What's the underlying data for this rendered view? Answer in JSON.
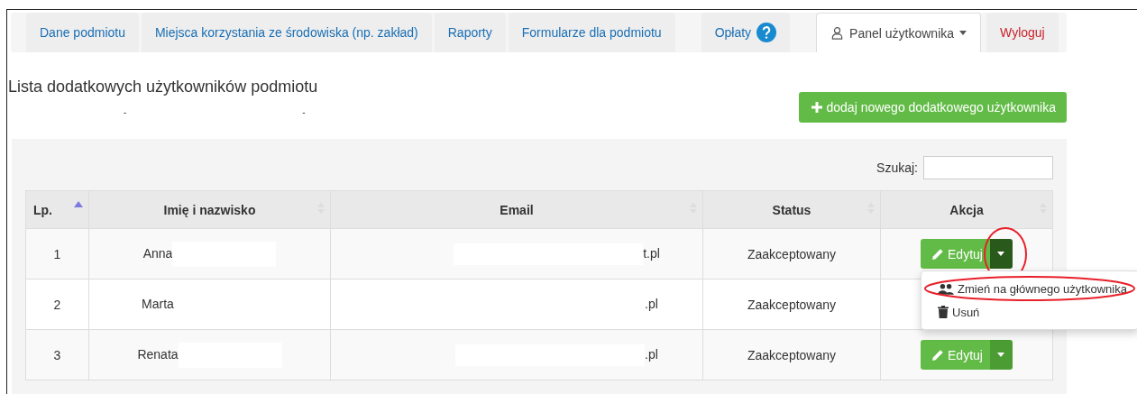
{
  "nav": {
    "tabs": [
      {
        "label": "Dane podmiotu",
        "selected": false,
        "kind": "link"
      },
      {
        "label": "Miejsca korzystania ze środowiska (np. zakład)",
        "selected": false,
        "kind": "link"
      },
      {
        "label": "Raporty",
        "selected": false,
        "kind": "link"
      },
      {
        "label": "Formularze dla podmiotu",
        "selected": false,
        "kind": "link"
      },
      {
        "label": "Opłaty",
        "selected": false,
        "kind": "help"
      },
      {
        "label": "Panel użytkownika",
        "selected": true,
        "kind": "user"
      },
      {
        "label": "Wyloguj",
        "selected": false,
        "kind": "logout"
      }
    ]
  },
  "page_title": "Lista dodatkowych użytkowników podmiotu",
  "redacted_line": [
    "-",
    "-"
  ],
  "add_button": "dodaj nowego dodatkowego użytkownika",
  "search": {
    "label": "Szukaj:"
  },
  "table": {
    "columns": [
      {
        "label": "Lp.",
        "sorted": true
      },
      {
        "label": "Imię i nazwisko",
        "sorted": false
      },
      {
        "label": "Email",
        "sorted": false
      },
      {
        "label": "Status",
        "sorted": false
      },
      {
        "label": "Akcja",
        "sorted": false
      }
    ],
    "rows": [
      {
        "lp": "1",
        "name": "Anna",
        "email": "t.pl",
        "status": "Zaakceptowany",
        "edit": "Edytuj",
        "menu_open": true,
        "circled": true
      },
      {
        "lp": "2",
        "name": "Marta",
        "email": ".pl",
        "status": "Zaakceptowany",
        "menu_open": false,
        "circled": false
      },
      {
        "lp": "3",
        "name": "Renata",
        "email": ".pl",
        "status": "Zaakceptowany",
        "edit": "Edytuj",
        "menu_open": false,
        "circled": false
      }
    ]
  },
  "dropdown": {
    "items": [
      {
        "label": "Zmień na głównego użytkownika",
        "kind": "users",
        "circled": true
      },
      {
        "label": "Usuń",
        "kind": "trash",
        "circled": false
      }
    ]
  }
}
